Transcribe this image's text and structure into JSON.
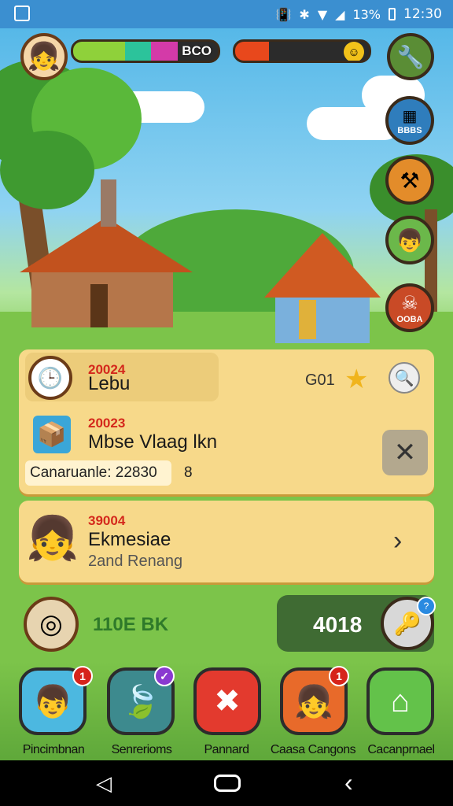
{
  "status_bar": {
    "battery": "13%",
    "time": "12:30",
    "icons": [
      "gallery-icon",
      "vibrate-icon",
      "bluetooth-icon",
      "wifi-icon",
      "signal-icon",
      "battery-icon"
    ]
  },
  "hud": {
    "xp_text": "BCO",
    "xp_fraction": 0.72,
    "energy_fraction": 0.25,
    "colors": {
      "xp_green": "#8fd13a",
      "xp_teal": "#2cc39b",
      "xp_pink": "#d43aa8",
      "energy": "#e8481c"
    }
  },
  "side_buttons": [
    {
      "name": "map-button",
      "label": "BBBS"
    },
    {
      "name": "tools-button",
      "label": ""
    },
    {
      "name": "villager-button",
      "label": ""
    },
    {
      "name": "skull-button",
      "label": "OOBA"
    }
  ],
  "quest_panel": {
    "row1": {
      "year": "20024",
      "title": "Lebu",
      "count": "G01"
    },
    "row2": {
      "year": "20023",
      "title": "Mbse Vlaag lkn",
      "caption": "Canaruanle: 22830",
      "caption_num": "8"
    }
  },
  "explore_panel": {
    "year": "39004",
    "title": "Ekmesiae",
    "subtitle": "2and Renang"
  },
  "resources": {
    "coins_text": "110E BK",
    "gems_value": "4018"
  },
  "bottom_nav": [
    {
      "label": "Pincimbnan",
      "badge": "1"
    },
    {
      "label": "Senrerioms",
      "badge": ""
    },
    {
      "label": "Pannard",
      "badge": ""
    },
    {
      "label": "Caasa Cangons",
      "badge": "1"
    },
    {
      "label": "Cacanprnael",
      "badge": ""
    }
  ]
}
